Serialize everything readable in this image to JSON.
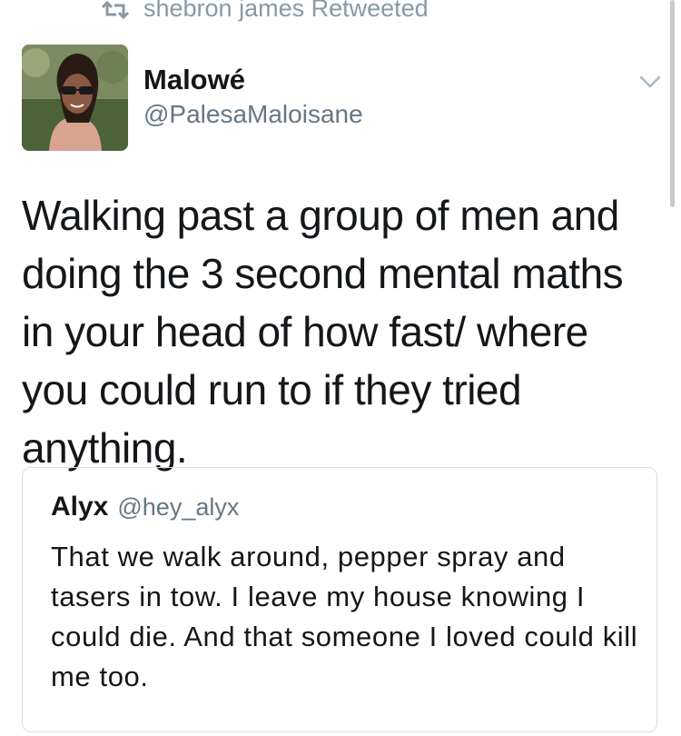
{
  "retweet_context": {
    "icon": "retweet-icon",
    "text": "shebron james Retweeted"
  },
  "tweet": {
    "author_name": "Malowé",
    "author_handle": "@PalesaMaloisane",
    "avatar_icon": "avatar",
    "menu_icon": "chevron-down-icon",
    "text": "Walking past a group of men and doing the 3 second mental maths in your head of how fast/ where you could run to if they tried anything."
  },
  "quoted_tweet": {
    "author_name": "Alyx",
    "author_handle": "@hey_alyx",
    "text": "That we walk around, pepper spray and tasers in tow. I leave my house knowing I could die. And that someone I loved could kill me too."
  },
  "colors": {
    "text_primary": "#14171a",
    "text_secondary": "#657786",
    "retweet_gray": "#8899a6",
    "quote_border": "#d6dde3"
  }
}
